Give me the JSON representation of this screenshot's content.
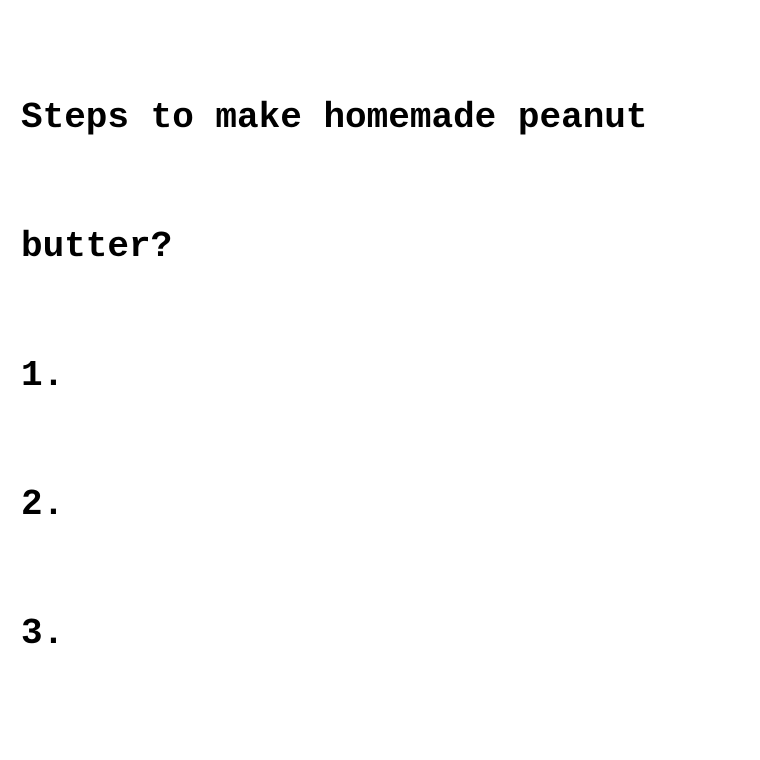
{
  "document": {
    "question_line_1": "Steps to make homemade peanut",
    "question_line_2": "butter?",
    "steps": [
      {
        "label": "1."
      },
      {
        "label": "2."
      },
      {
        "label": "3."
      }
    ]
  },
  "colors": {
    "background": "#ffffff",
    "text": "#000000"
  }
}
